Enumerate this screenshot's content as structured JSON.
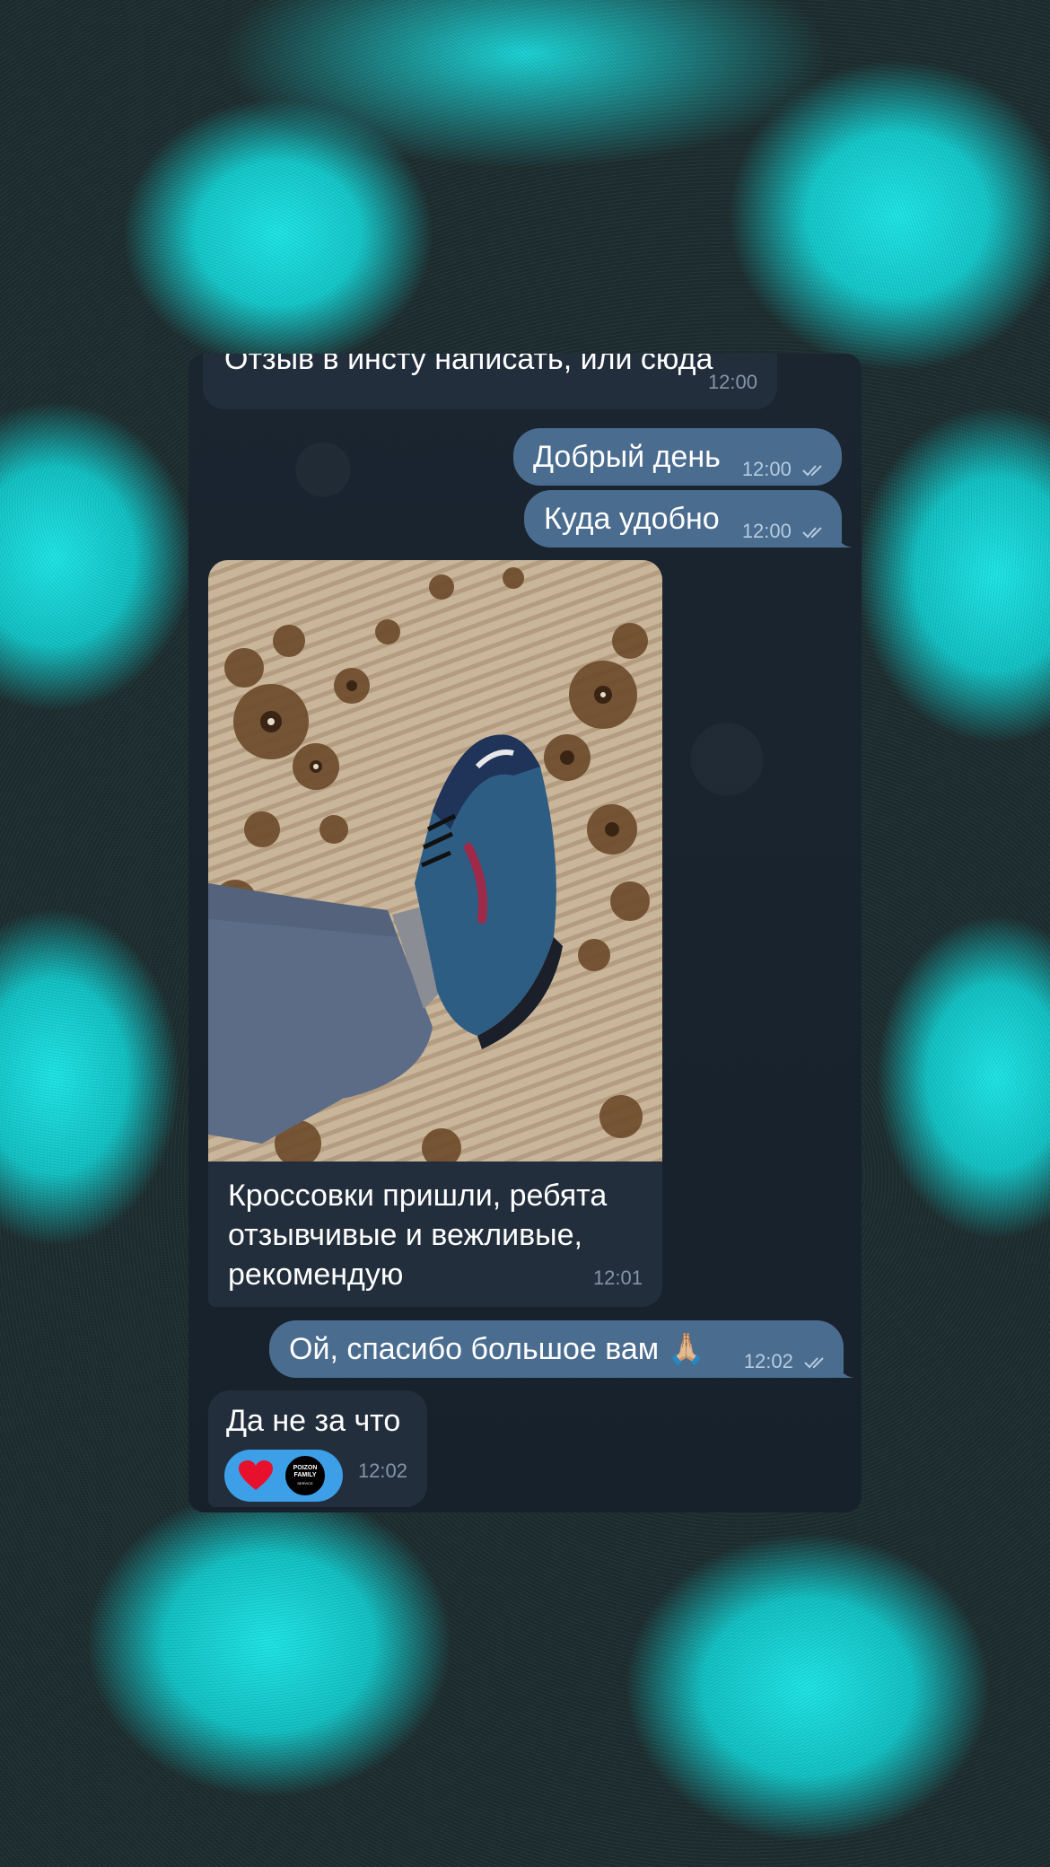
{
  "messages": [
    {
      "id": "m1",
      "direction": "in",
      "text": "Отзыв в инсту написать, или сюда",
      "time": "12:00"
    },
    {
      "id": "m2",
      "direction": "out",
      "text": "Добрый день",
      "time": "12:00",
      "read": true
    },
    {
      "id": "m3",
      "direction": "out",
      "text": "Куда удобно",
      "time": "12:00",
      "read": true
    },
    {
      "id": "m4",
      "direction": "in",
      "type": "photo",
      "caption": "Кроссовки пришли, ребята отзывчивые и вежливые, рекомендую",
      "time": "12:01"
    },
    {
      "id": "m5",
      "direction": "out",
      "text": "Ой, спасибо большое вам 🙏🏼",
      "time": "12:02",
      "read": true
    },
    {
      "id": "m6",
      "direction": "in",
      "text": "Да не за что",
      "time": "12:02"
    }
  ],
  "reaction": {
    "emoji": "heart-icon",
    "avatar_line1": "POIZON",
    "avatar_line2": "FAMILY",
    "avatar_line3": "SERVICE"
  },
  "colors": {
    "incoming_bubble": "#232e3c",
    "outgoing_bubble": "#4a6c8f",
    "chat_background": "#17212b",
    "reaction_pill": "#3d9fe8",
    "backdrop_accent": "#1fe3e3"
  }
}
